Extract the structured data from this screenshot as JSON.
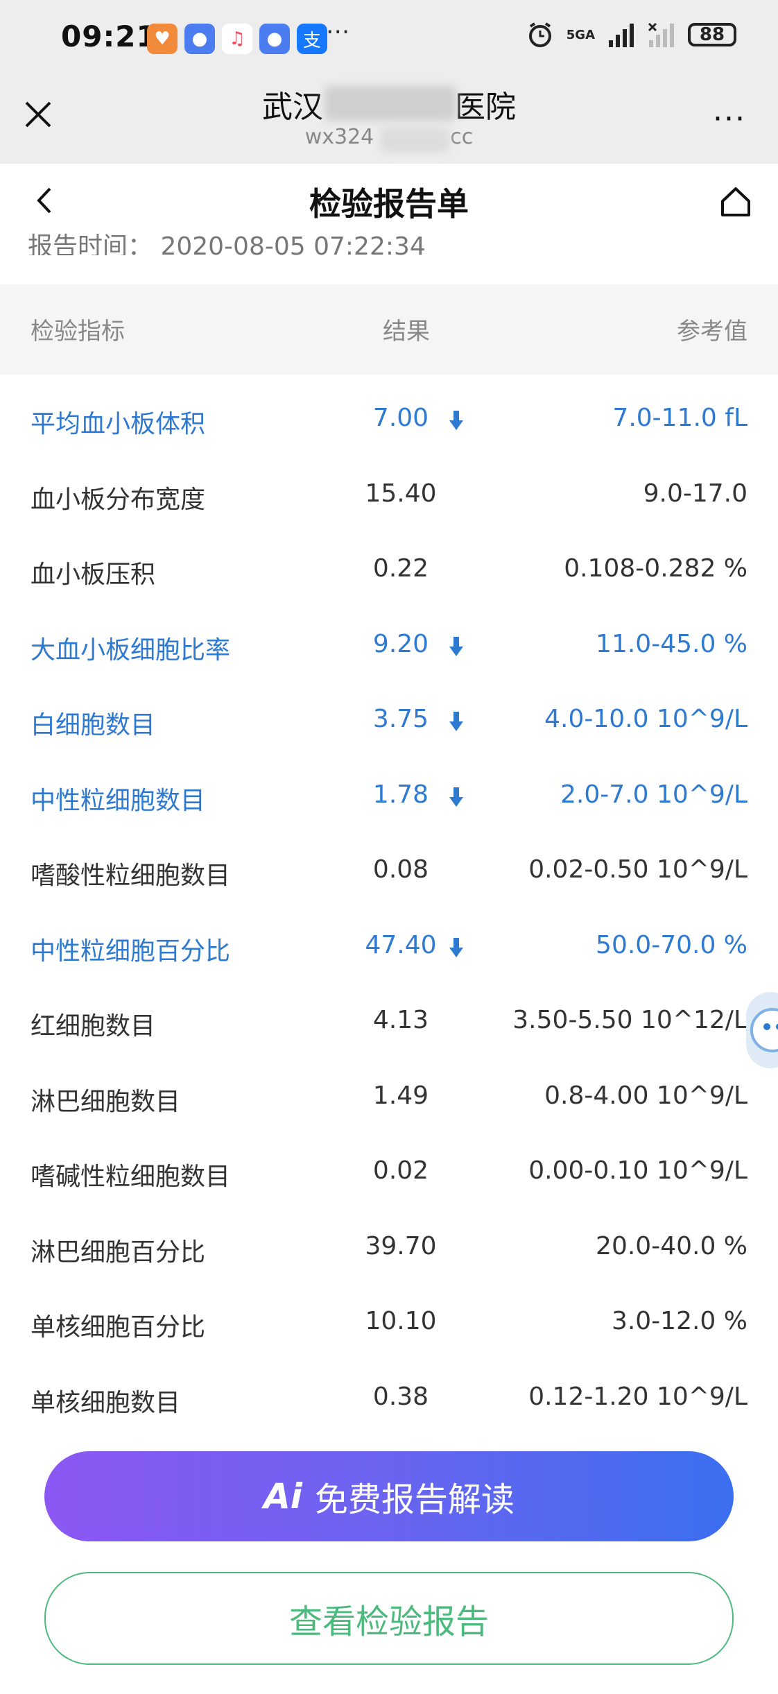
{
  "status_bar": {
    "time": "09:21",
    "battery": "88",
    "network": "5GA",
    "more_dots": "···",
    "app_icons": [
      "heart-app-icon",
      "browser-icon",
      "music-icon",
      "browser-icon",
      "alipay-icon"
    ],
    "alipay_glyph": "支"
  },
  "title_bar": {
    "hospital_name_left": "武汉",
    "hospital_name_right": "医院",
    "app_id_left": "wx324",
    "app_id_right": "cc",
    "more_label": "···"
  },
  "page": {
    "title": "检验报告单",
    "cut_line": "报告时间： 2020-08-05 07:22:34"
  },
  "table": {
    "headers": {
      "indicator": "检验指标",
      "result": "结果",
      "reference": "参考值"
    },
    "rows": [
      {
        "name": "平均血小板体积",
        "result": "7.00",
        "reference": "7.0-11.0 fL",
        "low": true
      },
      {
        "name": "血小板分布宽度",
        "result": "15.40",
        "reference": "9.0-17.0",
        "low": false
      },
      {
        "name": "血小板压积",
        "result": "0.22",
        "reference": "0.108-0.282 %",
        "low": false
      },
      {
        "name": "大血小板细胞比率",
        "result": "9.20",
        "reference": "11.0-45.0 %",
        "low": true
      },
      {
        "name": "白细胞数目",
        "result": "3.75",
        "reference": "4.0-10.0 10^9/L",
        "low": true
      },
      {
        "name": "中性粒细胞数目",
        "result": "1.78",
        "reference": "2.0-7.0 10^9/L",
        "low": true
      },
      {
        "name": "嗜酸性粒细胞数目",
        "result": "0.08",
        "reference": "0.02-0.50 10^9/L",
        "low": false
      },
      {
        "name": "中性粒细胞百分比",
        "result": "47.40",
        "reference": "50.0-70.0 %",
        "low": true
      },
      {
        "name": "红细胞数目",
        "result": "4.13",
        "reference": "3.50-5.50 10^12/L",
        "low": false
      },
      {
        "name": "淋巴细胞数目",
        "result": "1.49",
        "reference": "0.8-4.00 10^9/L",
        "low": false
      },
      {
        "name": "嗜碱性粒细胞数目",
        "result": "0.02",
        "reference": "0.00-0.10 10^9/L",
        "low": false
      },
      {
        "name": "淋巴细胞百分比",
        "result": "39.70",
        "reference": "20.0-40.0 %",
        "low": false
      },
      {
        "name": "单核细胞百分比",
        "result": "10.10",
        "reference": "3.0-12.0 %",
        "low": false
      },
      {
        "name": "单核细胞数目",
        "result": "0.38",
        "reference": "0.12-1.20 10^9/L",
        "low": false
      }
    ]
  },
  "buttons": {
    "ai_logo": "Ai",
    "ai_label": "免费报告解读",
    "view_label": "查看检验报告"
  },
  "colors": {
    "low_value": "#2f7ad1",
    "ai_gradient_start": "#8c57f3",
    "ai_gradient_end": "#3c6ff0",
    "view_button": "#4cb97d"
  }
}
